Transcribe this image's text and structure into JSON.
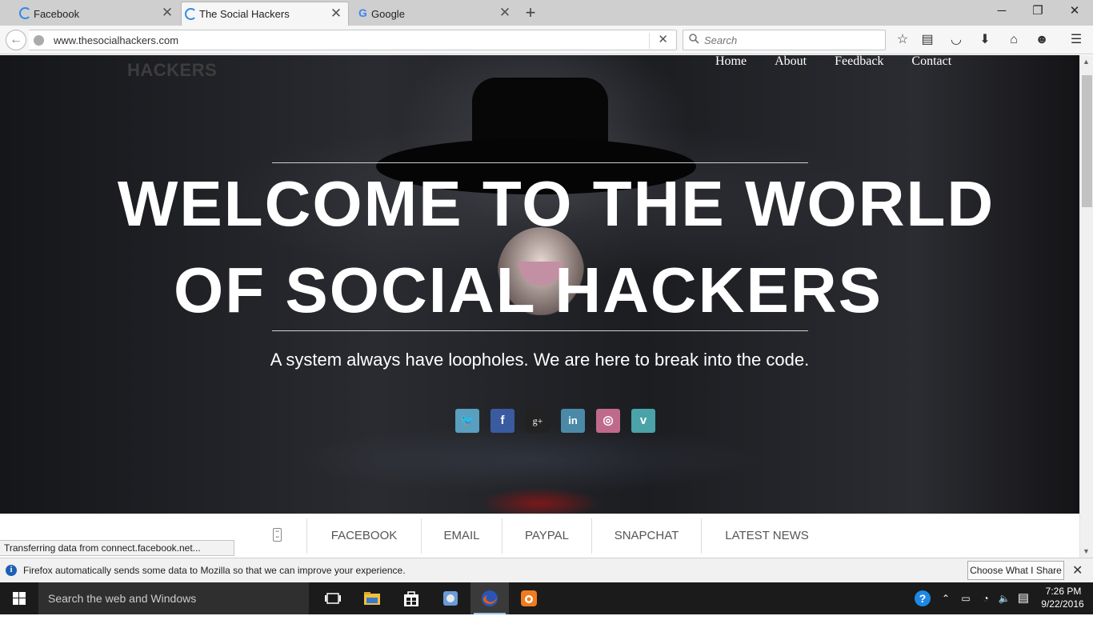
{
  "browser": {
    "tabs": [
      {
        "title": "Facebook",
        "icon": "loading-spinner"
      },
      {
        "title": "The Social Hackers",
        "icon": "loading-spinner",
        "active": true
      },
      {
        "title": "Google",
        "icon": "google-g-icon"
      }
    ],
    "url": "www.thesocialhackers.com",
    "search_placeholder": "Search"
  },
  "site": {
    "logo": "HACKERS",
    "nav": [
      "Home",
      "About",
      "Feedback",
      "Contact"
    ],
    "headline_line1": "WELCOME TO THE WORLD",
    "headline_line2": "OF SOCIAL HACKERS",
    "tagline": "A system always have loopholes. We are here to break into the code.",
    "social": [
      {
        "name": "twitter",
        "glyph": "🐦",
        "color": "#5a9ec0"
      },
      {
        "name": "facebook",
        "glyph": "f",
        "color": "#3b5ba0"
      },
      {
        "name": "google-plus",
        "glyph": "g+",
        "color": "#222222"
      },
      {
        "name": "linkedin",
        "glyph": "in",
        "color": "#4a8aa8"
      },
      {
        "name": "dribbble",
        "glyph": "◎",
        "color": "#c06a8a"
      },
      {
        "name": "vimeo",
        "glyph": "v",
        "color": "#4aa3a8"
      }
    ],
    "subnav": [
      "FACEBOOK",
      "EMAIL",
      "PAYPAL",
      "SNAPCHAT",
      "LATEST NEWS"
    ]
  },
  "status_text": "Transferring data from connect.facebook.net...",
  "notification": {
    "text": "Firefox automatically sends some data to Mozilla so that we can improve your experience.",
    "button": "Choose What I Share"
  },
  "taskbar": {
    "search_text": "Search the web and Windows",
    "time": "7:26 PM",
    "date": "9/22/2016"
  },
  "colors": {
    "accent_blue": "#2e8ae6",
    "firefox_orange": "#e66000"
  }
}
